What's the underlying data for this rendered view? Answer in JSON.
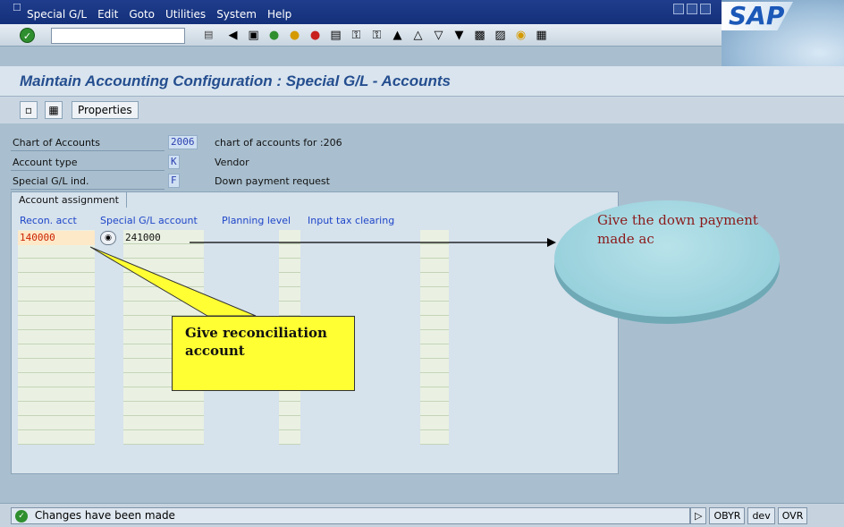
{
  "menubar": {
    "items": [
      "Special G/L",
      "Edit",
      "Goto",
      "Utilities",
      "System",
      "Help"
    ],
    "logo": "SAP"
  },
  "toolbar": {
    "command_value": "",
    "icons": [
      "back-icon",
      "save-icon",
      "enter-icon",
      "exit-icon",
      "cancel-icon",
      "print-icon",
      "find-icon",
      "find-next-icon",
      "first-page-icon",
      "prev-page-icon",
      "next-page-icon",
      "last-page-icon",
      "create-session-icon",
      "shortcut-icon",
      "help-icon",
      "layout-icon"
    ]
  },
  "screen": {
    "title": "Maintain Accounting Configuration : Special G/L - Accounts"
  },
  "app_toolbar": {
    "properties_label": "Properties"
  },
  "header_fields": [
    {
      "label": "Chart of Accounts",
      "value": "2006",
      "description": "chart of accounts for :206"
    },
    {
      "label": "Account type",
      "value": "K",
      "description": "Vendor"
    },
    {
      "label": "Special G/L ind.",
      "value": "F",
      "description": "Down payment request"
    }
  ],
  "assignment": {
    "tab_label": "Account assignment",
    "columns": [
      "Recon. acct",
      "Special G/L account",
      "Planning level",
      "Input tax clearing"
    ],
    "rows": [
      {
        "recon_acct": "140000",
        "special_gl_account": "241000",
        "planning_level": "",
        "input_tax_clearing": ""
      }
    ]
  },
  "annotations": {
    "yellow_callout": "Give reconciliation account",
    "circle_callout": "Give the down payment made ac"
  },
  "statusbar": {
    "message": "Changes have been made",
    "transaction": "OBYR",
    "system": "dev",
    "mode": "OVR"
  },
  "colors": {
    "menubar": "#14307a",
    "background": "#a9bfcf",
    "title_text": "#254e8f",
    "column_header": "#1e46c8",
    "recon_value": "#cc2200",
    "callout_yellow": "#ffff33",
    "callout_circle": "#8ccad6"
  }
}
